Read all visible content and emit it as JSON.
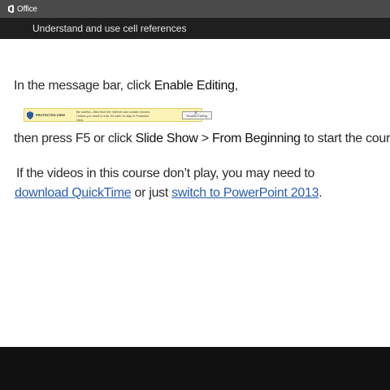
{
  "app": {
    "brand": "Office",
    "title": "Understand and use cell references"
  },
  "content": {
    "line1": {
      "pre": "In the message bar, click ",
      "bold": "Enable Editing",
      "post": ","
    },
    "message_bar": {
      "label": "PROTECTED VIEW",
      "message": "Be careful—files from the Internet can contain viruses. Unless you need to edit, it's safer to stay in Protected View.",
      "button": "Enable Editing",
      "close": "X"
    },
    "line2": {
      "pre": "then press F5 or click ",
      "bold1": "Slide Show",
      "sep": " > ",
      "bold2": "From Beginning",
      "post": " to start the course."
    },
    "line3": "If the videos in this course don’t play, you may need to",
    "line4": {
      "link1": "download QuickTime",
      "mid": " or just ",
      "link2": "switch to PowerPoint 2013",
      "post": "."
    }
  },
  "colors": {
    "link": "#2a5db0",
    "top_bar": "#4a4a4a",
    "title_bar": "#1f1f1f",
    "bottom_bar": "#111111",
    "message_bar": "#fcf3b8"
  }
}
